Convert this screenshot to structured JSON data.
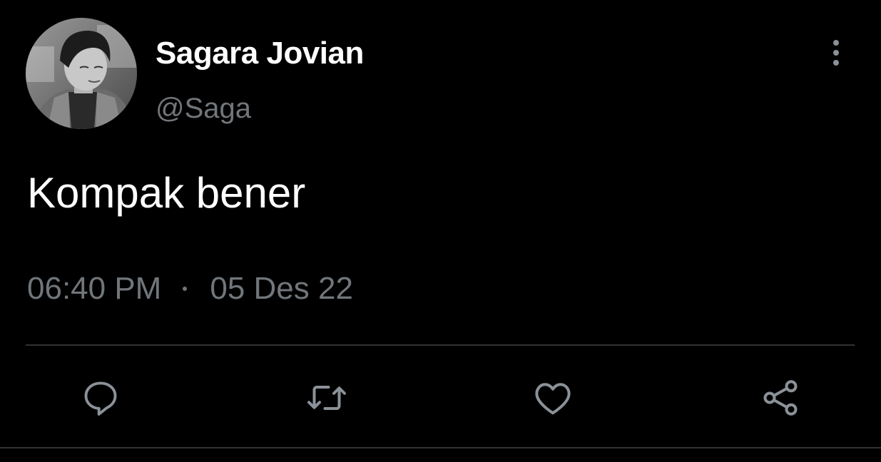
{
  "tweet": {
    "author": {
      "display_name": "Sagara Jovian",
      "handle": "@Saga",
      "avatar_icon": "user-avatar"
    },
    "text": "Kompak bener",
    "time": "06:40 PM",
    "date": "05 Des 22",
    "more_icon": "more-vertical-icon"
  },
  "actions": [
    {
      "name": "reply",
      "icon": "reply-icon"
    },
    {
      "name": "retweet",
      "icon": "retweet-icon"
    },
    {
      "name": "like",
      "icon": "heart-icon"
    },
    {
      "name": "share",
      "icon": "share-icon"
    }
  ],
  "colors": {
    "background": "#000000",
    "primary_text": "#ffffff",
    "secondary_text": "#71767b",
    "divider": "#2f3336",
    "icon": "#8b9198"
  }
}
